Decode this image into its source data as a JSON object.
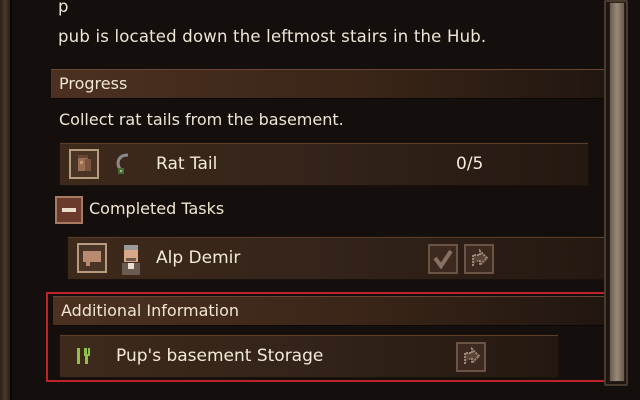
{
  "description": {
    "line1": "p                                                               ",
    "line2": "pub is located down the leftmost stairs in the Hub."
  },
  "progress": {
    "header": "Progress",
    "objective": "Collect rat tails from the basement.",
    "item": {
      "name": "Rat Tail",
      "count": "0/5",
      "icon": "rat-tail-icon"
    }
  },
  "completed": {
    "header": "Completed Tasks",
    "toggle_icon": "minus-icon",
    "items": [
      {
        "name": "Alp Demir",
        "icon": "speech-bubble-icon",
        "portrait": "npc-portrait-icon",
        "status": "checkmark-icon"
      }
    ]
  },
  "additional": {
    "header": "Additional Information",
    "items": [
      {
        "name": "Pup's basement Storage",
        "icon": "fork-knife-icon"
      }
    ]
  },
  "colors": {
    "background": "#140f0c",
    "section_header": "#4c3120",
    "row": "#3e2a1b",
    "text": "#ece2d0",
    "highlight": "#c0222a",
    "accent_green": "#8fc24a"
  }
}
